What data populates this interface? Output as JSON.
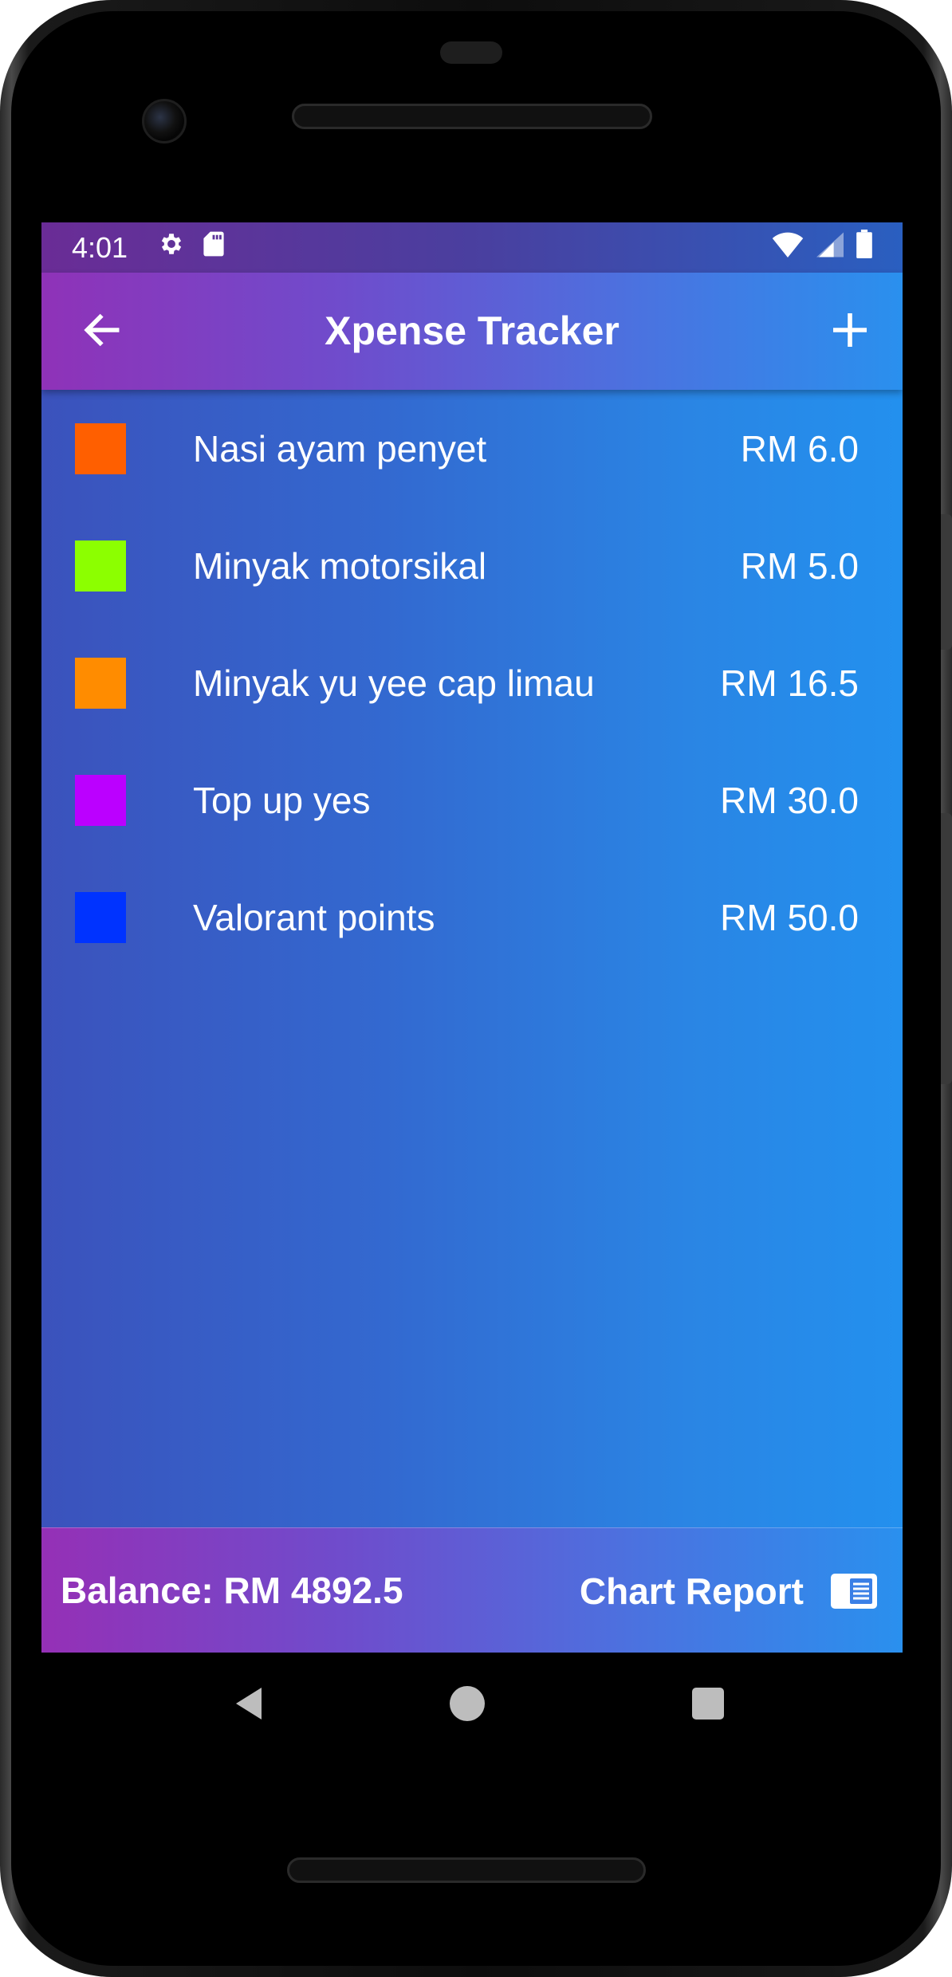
{
  "status_bar": {
    "time": "4:01",
    "left_icons": [
      "gear-icon",
      "sd-card-icon"
    ],
    "right_icons": [
      "wifi-icon",
      "signal-icon",
      "battery-icon"
    ]
  },
  "app_bar": {
    "title": "Xpense Tracker",
    "back_icon": "arrow-left-icon",
    "add_icon": "plus-icon"
  },
  "expenses": [
    {
      "name": "Nasi ayam penyet",
      "amount": "RM 6.0",
      "color": "#FF5F00"
    },
    {
      "name": "Minyak motorsikal",
      "amount": "RM 5.0",
      "color": "#8CFF00"
    },
    {
      "name": "Minyak yu yee cap limau",
      "amount": "RM 16.5",
      "color": "#FF8C00"
    },
    {
      "name": "Top up yes",
      "amount": "RM 30.0",
      "color": "#BB00FF"
    },
    {
      "name": "Valorant points",
      "amount": "RM 50.0",
      "color": "#0033FF"
    }
  ],
  "bottom_bar": {
    "balance": "Balance: RM 4892.5",
    "chart_report": "Chart Report",
    "chart_report_icon": "report-icon"
  },
  "nav_bar": {
    "icons": [
      "nav-back-icon",
      "nav-home-icon",
      "nav-recent-icon"
    ]
  },
  "colors": {
    "gradient_start": "#8F32B8",
    "gradient_end": "#2390EE"
  }
}
